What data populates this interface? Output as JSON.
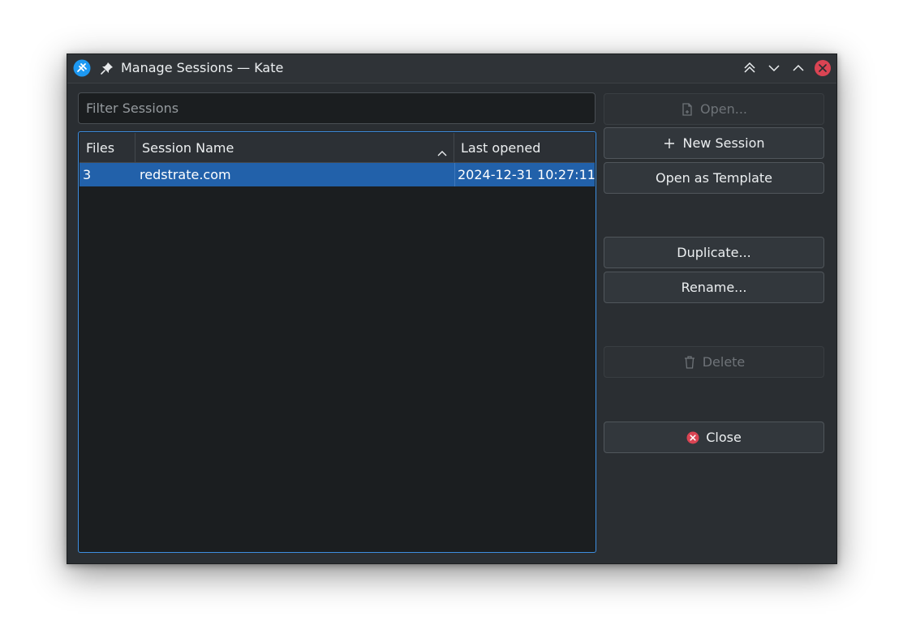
{
  "window": {
    "title": "Manage Sessions — Kate",
    "icons": [
      "kate-app-icon",
      "pin-icon",
      "keep-above-icon",
      "minimize-icon",
      "maximize-icon",
      "close-icon"
    ]
  },
  "filter": {
    "placeholder": "Filter Sessions",
    "value": ""
  },
  "table": {
    "columns": [
      "Files",
      "Session Name",
      "Last opened"
    ],
    "sort_column": "Session Name",
    "rows": [
      {
        "files": "3",
        "name": "redstrate.com",
        "last_opened": "2024-12-31  10:27:11",
        "selected": true
      }
    ]
  },
  "buttons": {
    "open": "Open...",
    "new_session": "New Session",
    "open_template": "Open as Template",
    "duplicate": "Duplicate...",
    "rename": "Rename...",
    "delete": "Delete",
    "close": "Close"
  },
  "colors": {
    "selection": "#2261aa",
    "focus_border": "#3d8ee0",
    "close_red": "#da4453",
    "background": "#2a2e32"
  }
}
